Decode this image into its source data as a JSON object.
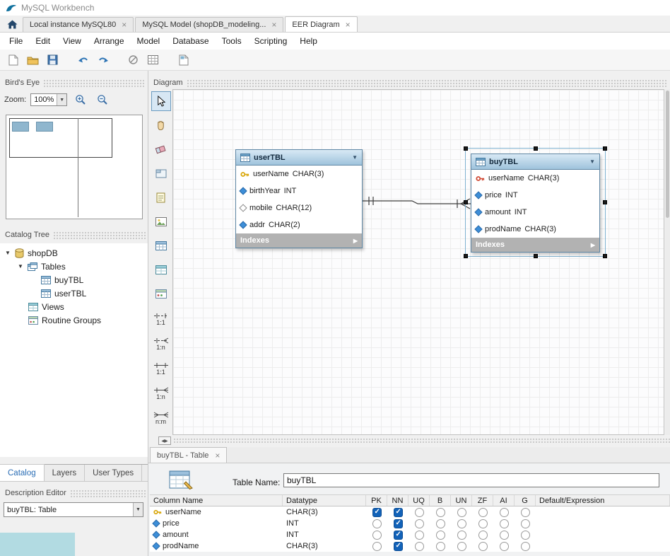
{
  "window": {
    "title": "MySQL Workbench"
  },
  "top_tabs": [
    {
      "label": "Local instance MySQL80",
      "close": "×"
    },
    {
      "label": "MySQL Model (shopDB_modeling...",
      "close": "×"
    },
    {
      "label": "EER Diagram",
      "close": "×"
    }
  ],
  "menu": [
    "File",
    "Edit",
    "View",
    "Arrange",
    "Model",
    "Database",
    "Tools",
    "Scripting",
    "Help"
  ],
  "birdseye": {
    "header": "Bird's Eye",
    "zoom_label": "Zoom:",
    "zoom_value": "100%"
  },
  "catalog_tree": {
    "header": "Catalog Tree",
    "nodes": [
      {
        "label": "shopDB"
      },
      {
        "label": "Tables"
      },
      {
        "label": "buyTBL"
      },
      {
        "label": "userTBL"
      },
      {
        "label": "Views"
      },
      {
        "label": "Routine Groups"
      }
    ]
  },
  "panel_tabs": [
    {
      "label": "Catalog"
    },
    {
      "label": "Layers"
    },
    {
      "label": "User Types"
    }
  ],
  "description_editor": {
    "header": "Description Editor",
    "value": "buyTBL: Table"
  },
  "diagram": {
    "header": "Diagram",
    "rel_tools": [
      "1:1",
      "1:n",
      "1:1",
      "1:n",
      "n:m"
    ],
    "tables": [
      {
        "name": "userTBL",
        "footer": "Indexes",
        "columns": [
          {
            "name": "userName",
            "type": "CHAR(3)",
            "icon": "primary-key"
          },
          {
            "name": "birthYear",
            "type": "INT",
            "icon": "not-null-diamond"
          },
          {
            "name": "mobile",
            "type": "CHAR(12)",
            "icon": "nullable-diamond"
          },
          {
            "name": "addr",
            "type": "CHAR(2)",
            "icon": "not-null-diamond"
          }
        ]
      },
      {
        "name": "buyTBL",
        "footer": "Indexes",
        "columns": [
          {
            "name": "userName",
            "type": "CHAR(3)",
            "icon": "foreign-primary-key"
          },
          {
            "name": "price",
            "type": "INT",
            "icon": "not-null-diamond"
          },
          {
            "name": "amount",
            "type": "INT",
            "icon": "not-null-diamond"
          },
          {
            "name": "prodName",
            "type": "CHAR(3)",
            "icon": "not-null-diamond"
          }
        ]
      }
    ]
  },
  "editor": {
    "tab_label": "buyTBL - Table",
    "tab_close": "×",
    "table_name_label": "Table Name:",
    "table_name_value": "buyTBL",
    "grid_headers": [
      "Column Name",
      "Datatype",
      "PK",
      "NN",
      "UQ",
      "B",
      "UN",
      "ZF",
      "AI",
      "G",
      "Default/Expression"
    ],
    "rows": [
      {
        "name": "userName",
        "datatype": "CHAR(3)",
        "icon": "primary-key",
        "pk": true,
        "nn": true,
        "uq": false,
        "b": false,
        "un": false,
        "zf": false,
        "ai": false,
        "g": false,
        "default": ""
      },
      {
        "name": "price",
        "datatype": "INT",
        "icon": "not-null-diamond",
        "pk": false,
        "nn": true,
        "uq": false,
        "b": false,
        "un": false,
        "zf": false,
        "ai": false,
        "g": false,
        "default": ""
      },
      {
        "name": "amount",
        "datatype": "INT",
        "icon": "not-null-diamond",
        "pk": false,
        "nn": true,
        "uq": false,
        "b": false,
        "un": false,
        "zf": false,
        "ai": false,
        "g": false,
        "default": ""
      },
      {
        "name": "prodName",
        "datatype": "CHAR(3)",
        "icon": "not-null-diamond",
        "pk": false,
        "nn": true,
        "uq": false,
        "b": false,
        "un": false,
        "zf": false,
        "ai": false,
        "g": false,
        "default": ""
      }
    ]
  },
  "icons": {
    "app_logo": "mysql-dolphin",
    "home": "house",
    "primary_key": "yellow-key",
    "foreign_primary_key": "red-key",
    "not_null": "filled-blue-diamond",
    "nullable": "hollow-diamond"
  },
  "colors": {
    "accent_blue": "#2d74b5",
    "check_blue": "#1262b8",
    "table_header_blue": "#a9c9df",
    "indexes_gray": "#b2b2b2"
  }
}
